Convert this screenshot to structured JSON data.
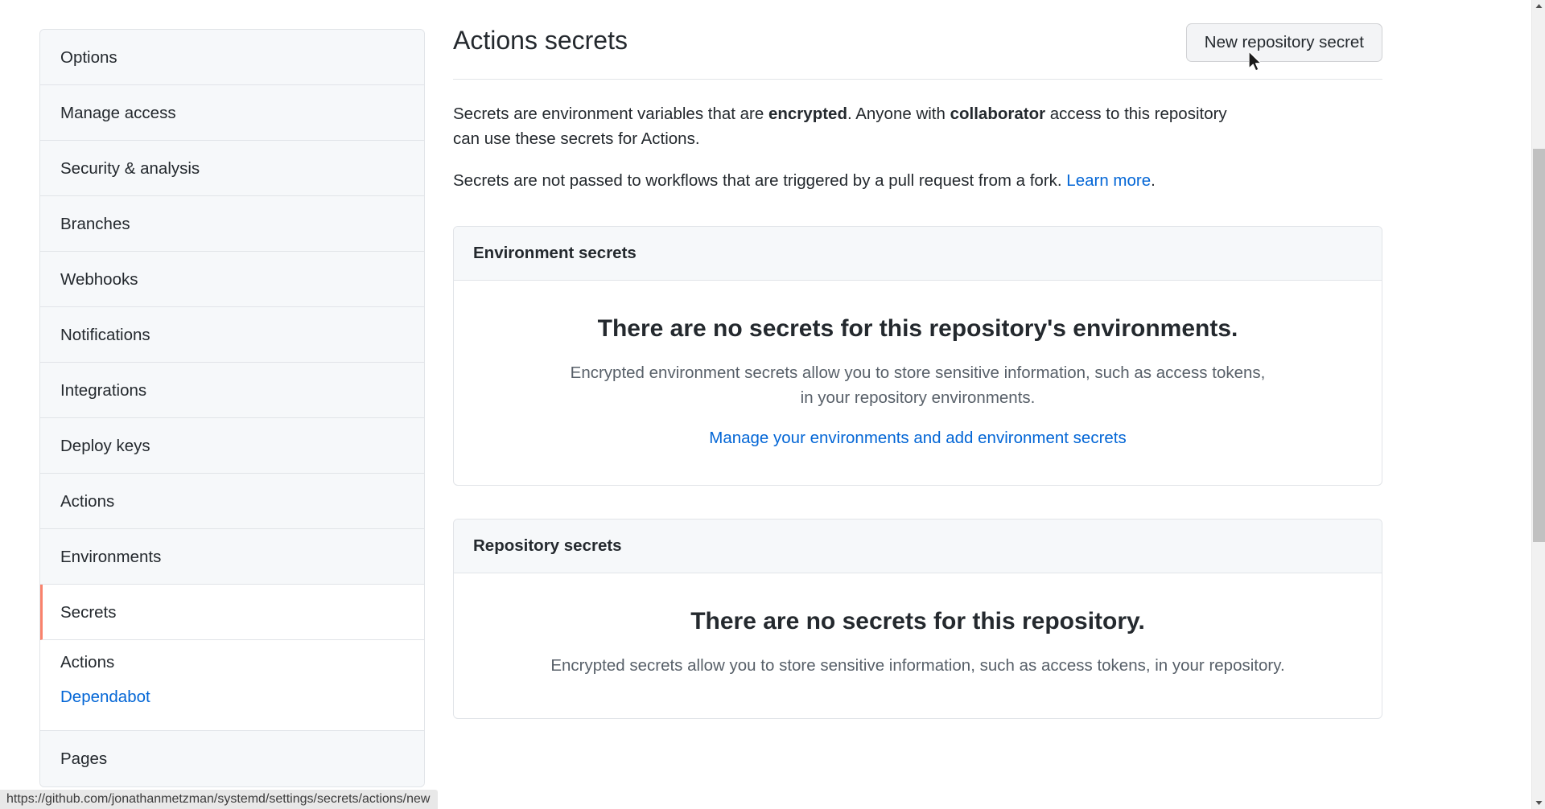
{
  "sidebar": {
    "items": [
      {
        "label": "Options",
        "selected": false
      },
      {
        "label": "Manage access",
        "selected": false
      },
      {
        "label": "Security & analysis",
        "selected": false
      },
      {
        "label": "Branches",
        "selected": false
      },
      {
        "label": "Webhooks",
        "selected": false
      },
      {
        "label": "Notifications",
        "selected": false
      },
      {
        "label": "Integrations",
        "selected": false
      },
      {
        "label": "Deploy keys",
        "selected": false
      },
      {
        "label": "Actions",
        "selected": false
      },
      {
        "label": "Environments",
        "selected": false
      },
      {
        "label": "Secrets",
        "selected": true
      }
    ],
    "sub_items": [
      {
        "label": "Actions",
        "current": true
      },
      {
        "label": "Dependabot",
        "current": false
      }
    ],
    "trailing_items": [
      {
        "label": "Pages",
        "selected": false
      }
    ],
    "selected_accent_color": "#f9826c"
  },
  "header": {
    "title": "Actions secrets",
    "new_secret_button": "New repository secret"
  },
  "description": {
    "line1_part1": "Secrets are environment variables that are ",
    "line1_bold1": "encrypted",
    "line1_part2": ". Anyone with ",
    "line1_bold2": "collaborator",
    "line1_part3": " access to this repository can use these secrets for Actions.",
    "line2_text": "Secrets are not passed to workflows that are triggered by a pull request from a fork. ",
    "line2_link": "Learn more",
    "line2_suffix": "."
  },
  "environment_secrets": {
    "header": "Environment secrets",
    "blank_title": "There are no secrets for this repository's environments.",
    "blank_desc": "Encrypted environment secrets allow you to store sensitive information, such as access tokens, in your repository environments.",
    "manage_link": "Manage your environments and add environment secrets"
  },
  "repository_secrets": {
    "header": "Repository secrets",
    "blank_title": "There are no secrets for this repository.",
    "blank_desc": "Encrypted secrets allow you to store sensitive information, such as access tokens, in your repository."
  },
  "status_bar": {
    "url": "https://github.com/jonathanmetzman/systemd/settings/secrets/actions/new"
  },
  "colors": {
    "link": "#0366d6",
    "text": "#24292e",
    "muted": "#586069",
    "border": "#e1e4e8",
    "surface": "#f6f8fa",
    "accent": "#f9826c"
  }
}
